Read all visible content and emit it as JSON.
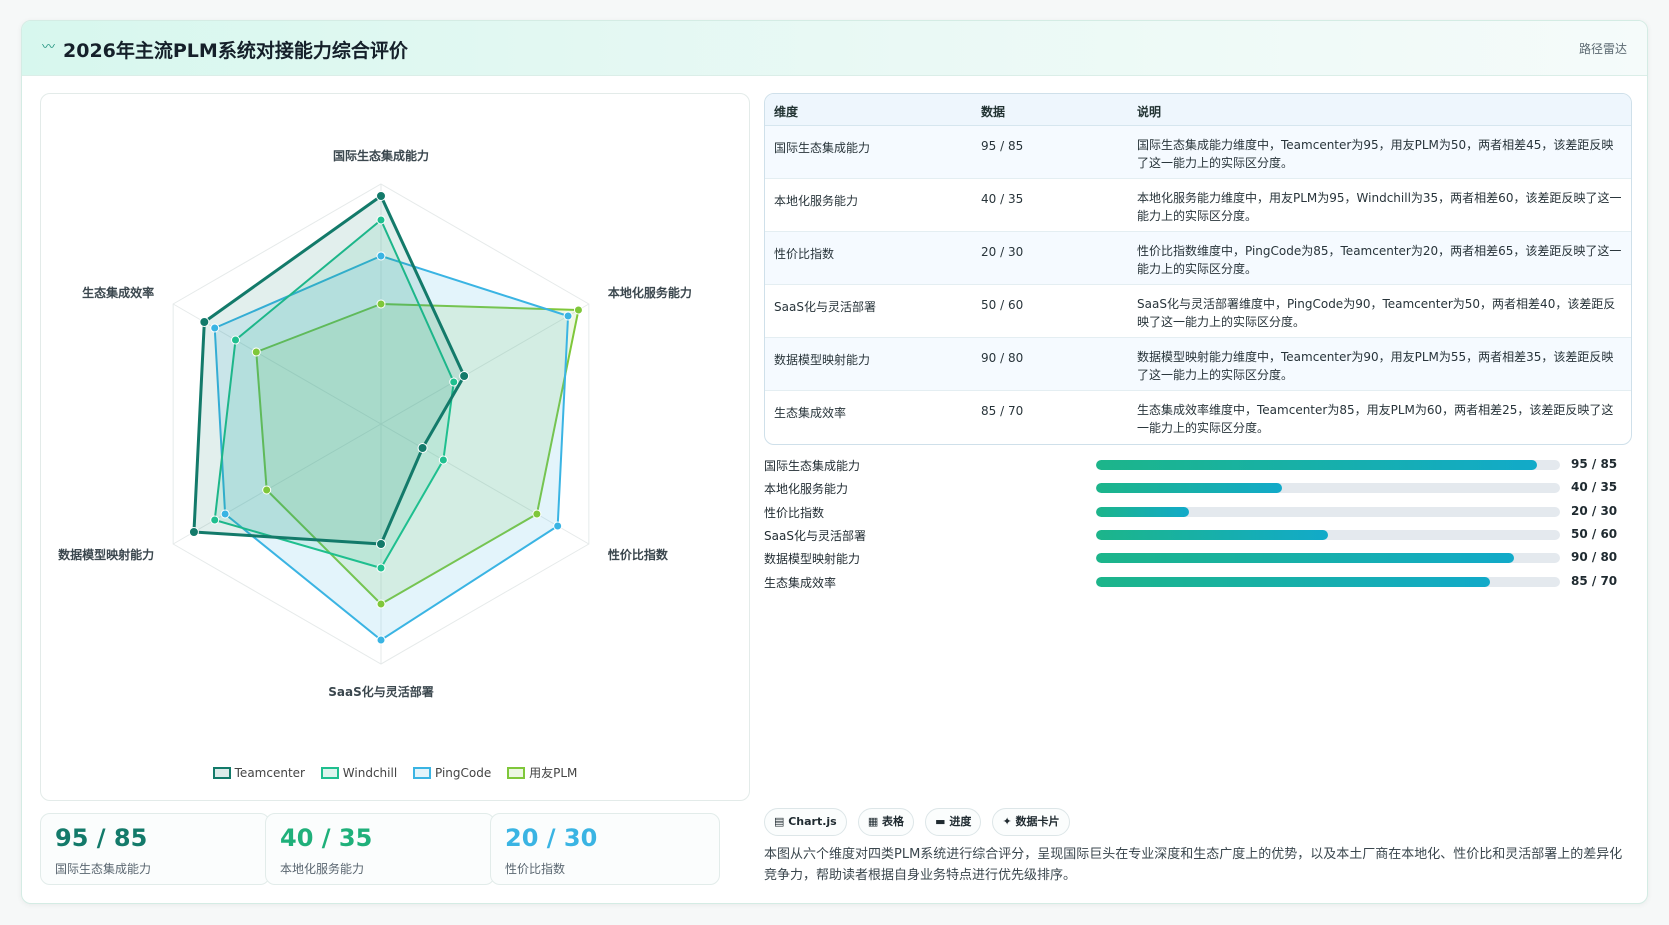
{
  "header": {
    "title": "2026年主流PLM系统对接能力综合评价",
    "tag": "路径雷达",
    "logo_icon": "wave-icon"
  },
  "colors": {
    "teamcenter": "#137a6a",
    "windchill": "#1fbf8f",
    "pingcode": "#3ab4e3",
    "yongyou": "#7fc73a"
  },
  "chart_data": {
    "type": "radar",
    "axes": [
      "国际生态集成能力",
      "本地化服务能力",
      "性价比指数",
      "SaaS化与灵活部署",
      "数据模型映射能力",
      "生态集成效率"
    ],
    "range": [
      0,
      100
    ],
    "series": [
      {
        "name": "Teamcenter",
        "values": [
          95,
          40,
          20,
          50,
          90,
          85
        ]
      },
      {
        "name": "Windchill",
        "values": [
          85,
          35,
          30,
          60,
          80,
          70
        ]
      },
      {
        "name": "PingCode",
        "values": [
          70,
          90,
          85,
          90,
          75,
          80
        ]
      },
      {
        "name": "用友PLM",
        "values": [
          50,
          95,
          75,
          75,
          55,
          60
        ]
      }
    ]
  },
  "legend": [
    "Teamcenter",
    "Windchill",
    "PingCode",
    "用友PLM"
  ],
  "stats": [
    {
      "value": "95 / 85",
      "label": "国际生态集成能力"
    },
    {
      "value": "40 / 35",
      "label": "本地化服务能力"
    },
    {
      "value": "20 / 30",
      "label": "性价比指数"
    }
  ],
  "table": {
    "headers": [
      "维度",
      "数据",
      "说明"
    ],
    "rows": [
      {
        "dim": "国际生态集成能力",
        "data": "95 / 85",
        "note": "国际生态集成能力维度中，Teamcenter为95，用友PLM为50，两者相差45，该差距反映了这一能力上的实际区分度。"
      },
      {
        "dim": "本地化服务能力",
        "data": "40 / 35",
        "note": "本地化服务能力维度中，用友PLM为95，Windchill为35，两者相差60，该差距反映了这一能力上的实际区分度。"
      },
      {
        "dim": "性价比指数",
        "data": "20 / 30",
        "note": "性价比指数维度中，PingCode为85，Teamcenter为20，两者相差65，该差距反映了这一能力上的实际区分度。"
      },
      {
        "dim": "SaaS化与灵活部署",
        "data": "50 / 60",
        "note": "SaaS化与灵活部署维度中，PingCode为90，Teamcenter为50，两者相差40，该差距反映了这一能力上的实际区分度。"
      },
      {
        "dim": "数据模型映射能力",
        "data": "90 / 80",
        "note": "数据模型映射能力维度中，Teamcenter为90，用友PLM为55，两者相差35，该差距反映了这一能力上的实际区分度。"
      },
      {
        "dim": "生态集成效率",
        "data": "85 / 70",
        "note": "生态集成效率维度中，Teamcenter为85，用友PLM为60，两者相差25，该差距反映了这一能力上的实际区分度。"
      }
    ]
  },
  "progress": [
    {
      "label": "国际生态集成能力",
      "value": "95 / 85",
      "fill": 0.95
    },
    {
      "label": "本地化服务能力",
      "value": "40 / 35",
      "fill": 0.4
    },
    {
      "label": "性价比指数",
      "value": "20 / 30",
      "fill": 0.2
    },
    {
      "label": "SaaS化与灵活部署",
      "value": "50 / 60",
      "fill": 0.5
    },
    {
      "label": "数据模型映射能力",
      "value": "90 / 80",
      "fill": 0.9
    },
    {
      "label": "生态集成效率",
      "value": "85 / 70",
      "fill": 0.85
    }
  ],
  "chips": [
    "▤ Chart.js",
    "▦ 表格",
    "▬ 进度",
    "✦ 数据卡片"
  ],
  "description": "本图从六个维度对四类PLM系统进行综合评分，呈现国际巨头在专业深度和生态广度上的优势，以及本土厂商在本地化、性价比和灵活部署上的差异化竞争力，帮助读者根据自身业务特点进行优先级排序。"
}
